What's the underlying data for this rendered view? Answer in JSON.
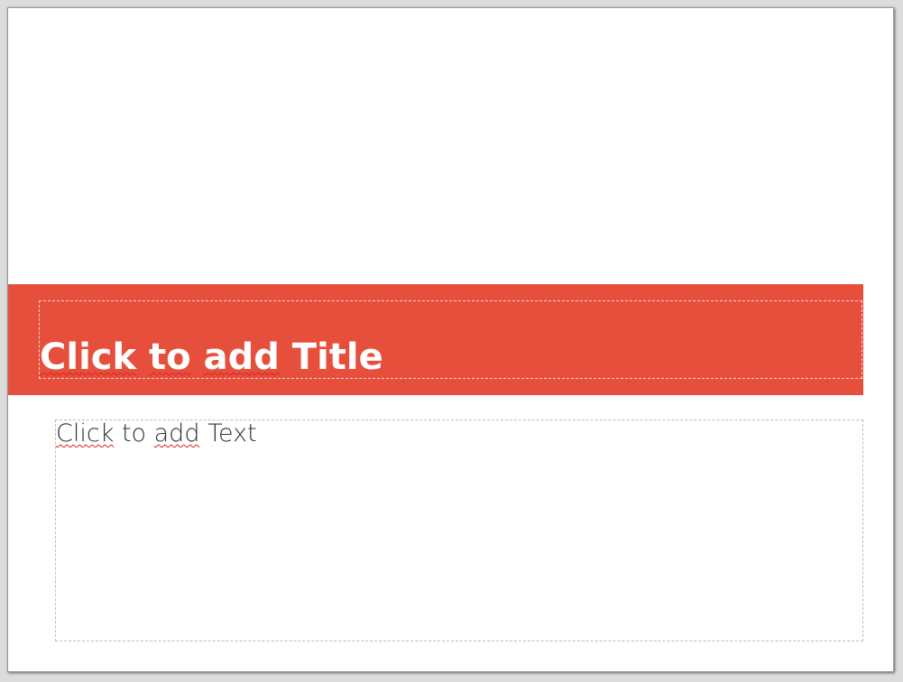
{
  "slide": {
    "title_words": [
      "Click",
      "to",
      "add",
      "Title"
    ],
    "body_words": [
      "Click",
      "to",
      "add",
      "Text"
    ],
    "spellcheck_flagged_title": [
      true,
      true,
      true,
      false
    ],
    "spellcheck_flagged_body": [
      true,
      false,
      true,
      false
    ]
  },
  "colors": {
    "title_band": "#e74f3d",
    "title_text": "#ffffff",
    "body_text": "#333333",
    "slide_background": "#ffffff",
    "workspace_background": "#dcdcdc",
    "spellcheck_underline": "#e02020"
  }
}
